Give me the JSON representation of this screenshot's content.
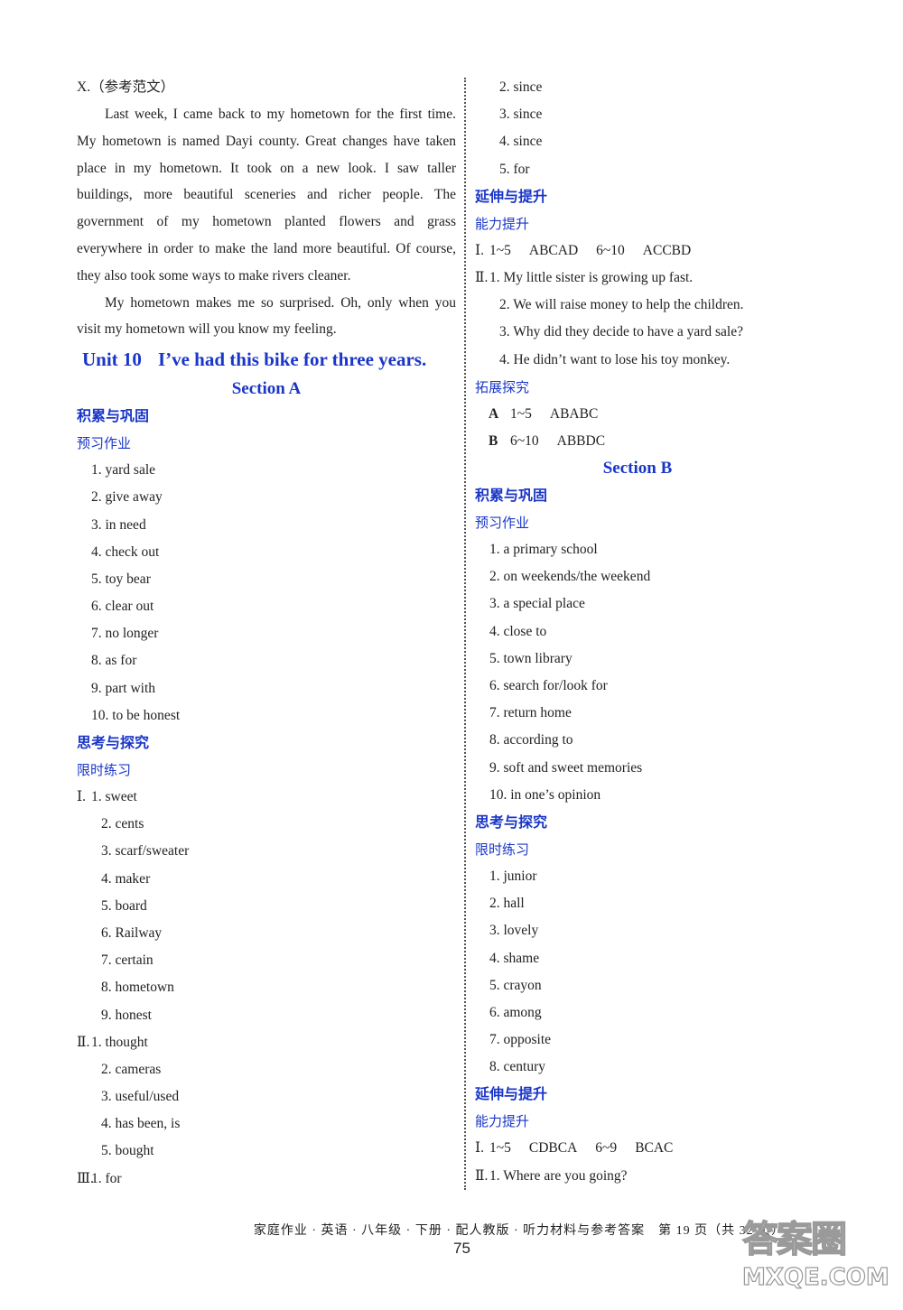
{
  "left": {
    "essay_label": "X.（参考范文）",
    "essay_paragraphs": [
      "Last week, I came back to my hometown for the first time. My hometown is named Dayi county. Great changes have taken place in my hometown. It took on a new look. I saw taller buildings, more beautiful sceneries and richer people. The government of my hometown planted flowers and grass everywhere in order to make the land more beautiful. Of course, they also took some ways to make rivers cleaner.",
      "My hometown makes me so surprised. Oh, only when you visit my hometown will you know my feeling."
    ],
    "unit_number": "Unit 10",
    "unit_title": "I’ve had this bike for three years.",
    "section_a_title": "Section A",
    "heading_accumulate": "积累与巩固",
    "heading_preview": "预习作业",
    "preview_items": [
      "1. yard sale",
      "2. give away",
      "3. in need",
      "4. check out",
      "5. toy bear",
      "6. clear out",
      "7. no longer",
      "8. as for",
      "9. part with",
      "10. to be honest"
    ],
    "heading_think": "思考与探究",
    "heading_timed": "限时练习",
    "part1_roman": "Ⅰ.",
    "part1_items": [
      "1. sweet",
      "2. cents",
      "3. scarf/sweater",
      "4. maker",
      "5. board",
      "6. Railway",
      "7. certain",
      "8. hometown",
      "9. honest"
    ],
    "part2_roman": "Ⅱ.",
    "part2_items": [
      "1. thought",
      "2. cameras",
      "3. useful/used",
      "4. has been, is",
      "5. bought"
    ],
    "part3_roman": "Ⅲ.",
    "part3_items": [
      "1. for"
    ]
  },
  "right": {
    "part3_cont_items": [
      "2. since",
      "3. since",
      "4. since",
      "5. for"
    ],
    "heading_extend": "延伸与提升",
    "heading_ability": "能力提升",
    "ability_part1_roman": "Ⅰ.",
    "ability_part1_range1": "1~5",
    "ability_part1_ans1": "ABCAD",
    "ability_part1_range2": "6~10",
    "ability_part1_ans2": "ACCBD",
    "ability_part2_roman": "Ⅱ.",
    "ability_part2_items": [
      "1. My little sister is growing up fast.",
      "2. We will raise money to help the children.",
      "3. Why did they decide to have a yard sale?",
      "4. He didn’t want to lose his toy monkey."
    ],
    "heading_explore": "拓展探究",
    "explore_rows": [
      {
        "letter": "A",
        "range": "1~5",
        "answers": "ABABC"
      },
      {
        "letter": "B",
        "range": "6~10",
        "answers": "ABBDC"
      }
    ],
    "section_b_title": "Section B",
    "heading_accumulate": "积累与巩固",
    "heading_preview": "预习作业",
    "preview_items": [
      "1. a primary school",
      "2. on weekends/the weekend",
      "3. a special place",
      "4. close to",
      "5. town library",
      "6. search for/look for",
      "7. return home",
      "8. according to",
      "9. soft and sweet memories",
      "10. in one’s opinion"
    ],
    "heading_think": "思考与探究",
    "heading_timed": "限时练习",
    "timed_items": [
      "1. junior",
      "2. hall",
      "3. lovely",
      "4. shame",
      "5. crayon",
      "6. among",
      "7. opposite",
      "8. century"
    ],
    "b_part1_roman": "Ⅰ.",
    "b_part1_range1": "1~5",
    "b_part1_ans1": "CDBCA",
    "b_part1_range2": "6~9",
    "b_part1_ans2": "BCAC",
    "b_part2_roman": "Ⅱ.",
    "b_part2_items": [
      "1. Where are you going?"
    ]
  },
  "footer": {
    "text": "家庭作业 · 英语 · 八年级 · 下册 · 配人教版 · 听力材料与参考答案　第 19 页（共 32 页）",
    "page_number": "75"
  },
  "watermark": {
    "cn": "答案圈",
    "en": "MXQE.COM"
  }
}
